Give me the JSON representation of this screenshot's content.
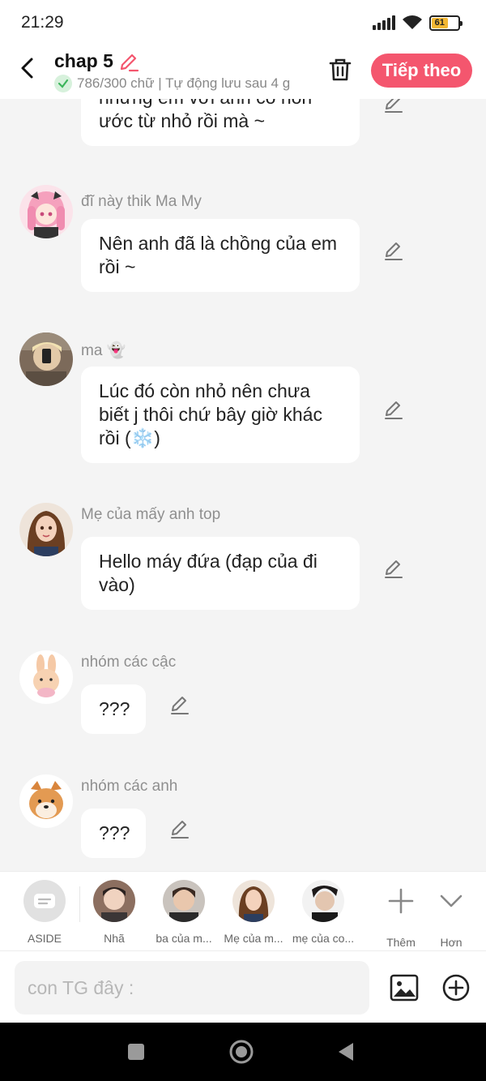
{
  "status_bar": {
    "time": "21:29",
    "battery": "61",
    "battery_level": 0.61
  },
  "header": {
    "title": "chap 5",
    "subtitle": "786/300 chữ | Tự động lưu sau 4 g",
    "next_label": "Tiếp theo"
  },
  "messages": [
    {
      "name": "",
      "text": "nhưng em với anh có hôn ước từ nhỏ rồi mà ~",
      "avatar": "none"
    },
    {
      "name": "đĩ này thik Ma My",
      "text": "Nên anh đã là chồng của em rồi ~",
      "avatar": "anime-girl-pink-hair"
    },
    {
      "name": "ma 👻",
      "text": "Lúc đó còn nhỏ nên chưa biết j thôi chứ bây giờ khác rồi (❄️)",
      "avatar": "blonde-boy-selfie"
    },
    {
      "name": "Mẹ của mấy anh top",
      "text": "Hello máy đứa (đạp của đi vào)",
      "avatar": "brown-hair-woman"
    },
    {
      "name": "nhóm các cậc",
      "text": "???",
      "avatar": "bunny"
    },
    {
      "name": "nhóm các anh",
      "text": "???",
      "avatar": "shiba-dog"
    }
  ],
  "character_bar": {
    "items": [
      {
        "label": "ASIDE",
        "icon": "aside-icon"
      },
      {
        "label": "Nhã",
        "icon": "boy-avatar"
      },
      {
        "label": "ba của m...",
        "icon": "man-avatar"
      },
      {
        "label": "Mẹ của m...",
        "icon": "woman-avatar"
      },
      {
        "label": "mẹ của co...",
        "icon": "dark-hair-avatar"
      }
    ],
    "more_label": "Thêm",
    "expand_label": "Hơn"
  },
  "input": {
    "placeholder": "con TG đây :",
    "value": ""
  }
}
